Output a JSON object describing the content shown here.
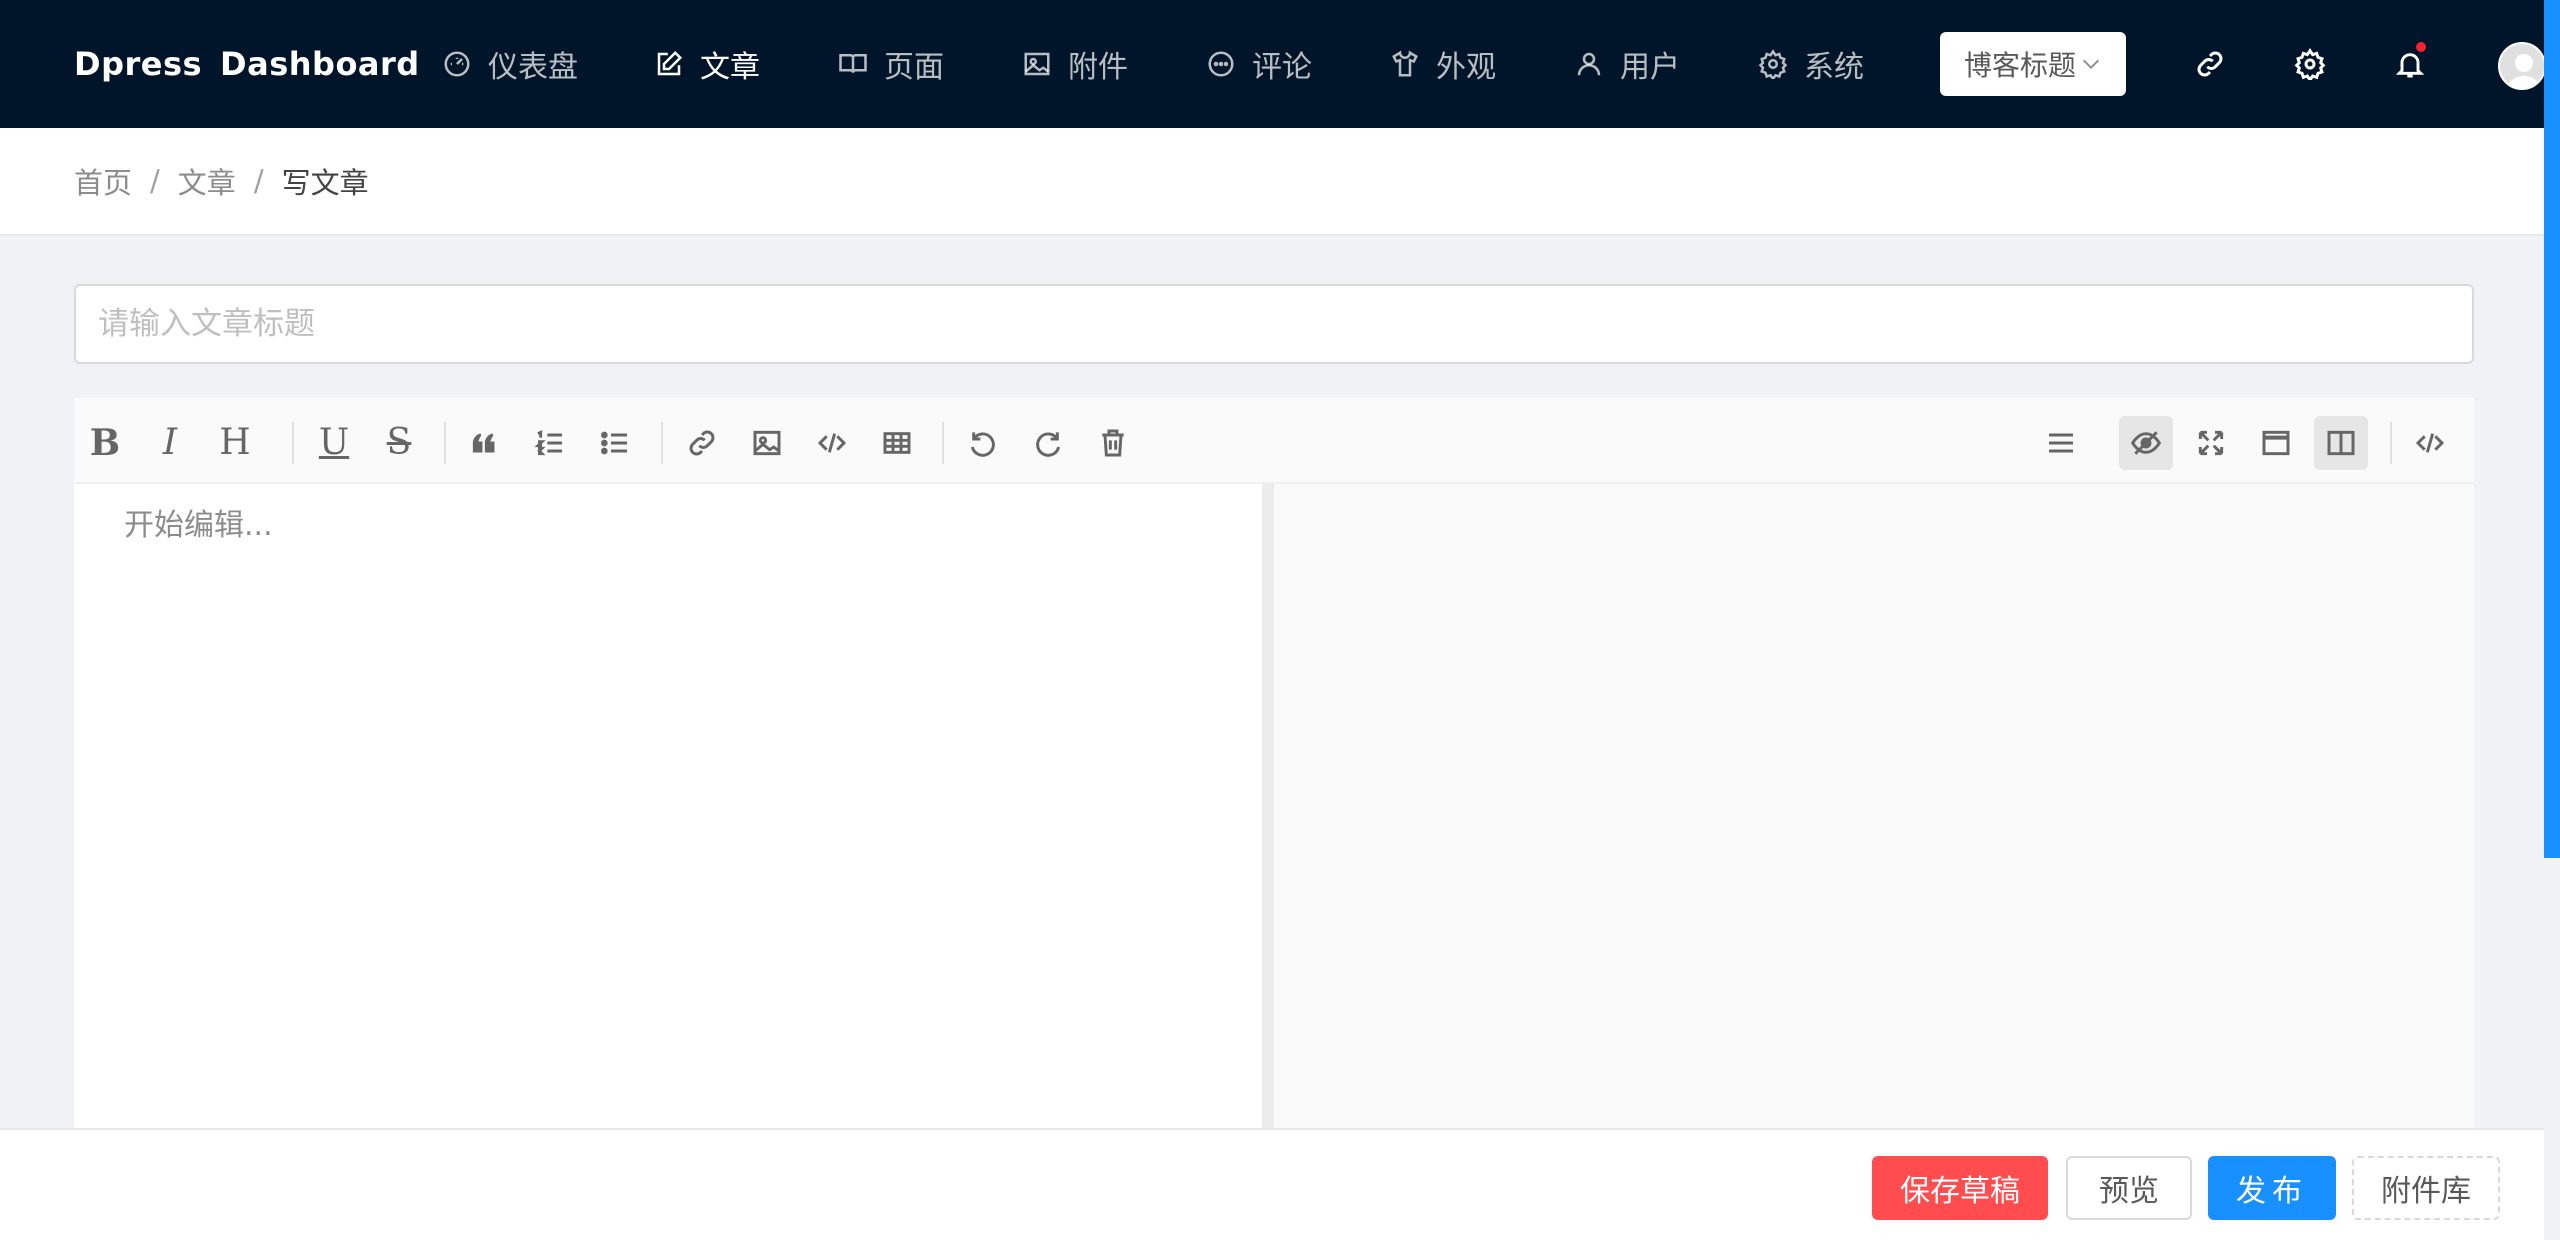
{
  "brand": {
    "word1": "Dpress",
    "word2": "Dashboard"
  },
  "nav": [
    {
      "label": "仪表盘",
      "icon": "dashboard-icon",
      "active": false
    },
    {
      "label": "文章",
      "icon": "edit-icon",
      "active": true
    },
    {
      "label": "页面",
      "icon": "book-icon",
      "active": false
    },
    {
      "label": "附件",
      "icon": "image-icon",
      "active": false
    },
    {
      "label": "评论",
      "icon": "comment-icon",
      "active": false
    },
    {
      "label": "外观",
      "icon": "shirt-icon",
      "active": false
    },
    {
      "label": "用户",
      "icon": "user-icon",
      "active": false
    },
    {
      "label": "系统",
      "icon": "gear-icon",
      "active": false
    }
  ],
  "blog_select": {
    "value": "博客标题"
  },
  "header_icons": [
    "link-icon",
    "settings-icon",
    "bell-icon",
    "avatar"
  ],
  "notification": {
    "has_unread": true,
    "dot_color": "#f5222d"
  },
  "breadcrumb": {
    "home": "首页",
    "section": "文章",
    "current": "写文章"
  },
  "title_input": {
    "value": "",
    "placeholder": "请输入文章标题"
  },
  "editor": {
    "placeholder": "开始编辑...",
    "toolbar_left": [
      "bold",
      "italic",
      "heading",
      "underline",
      "strikethrough",
      "quote",
      "ordered-list",
      "unordered-list",
      "link",
      "image",
      "code",
      "table",
      "undo",
      "redo",
      "clear"
    ],
    "toolbar_right": [
      "toc",
      "preview-toggle",
      "fullscreen",
      "page-fullscreen",
      "split-view",
      "html-code"
    ],
    "glyphs": {
      "bold": "B",
      "italic": "I",
      "heading": "H",
      "underline": "U",
      "strikethrough": "S"
    },
    "active_tools": [
      "preview-toggle",
      "split-view"
    ]
  },
  "actions": {
    "save_draft": "保存草稿",
    "preview": "预览",
    "publish": "发布",
    "attachments": "附件库"
  },
  "colors": {
    "topbar": "#001529",
    "accent": "#1890ff",
    "danger": "#ff4d4f",
    "page_bg": "#f0f2f5"
  }
}
